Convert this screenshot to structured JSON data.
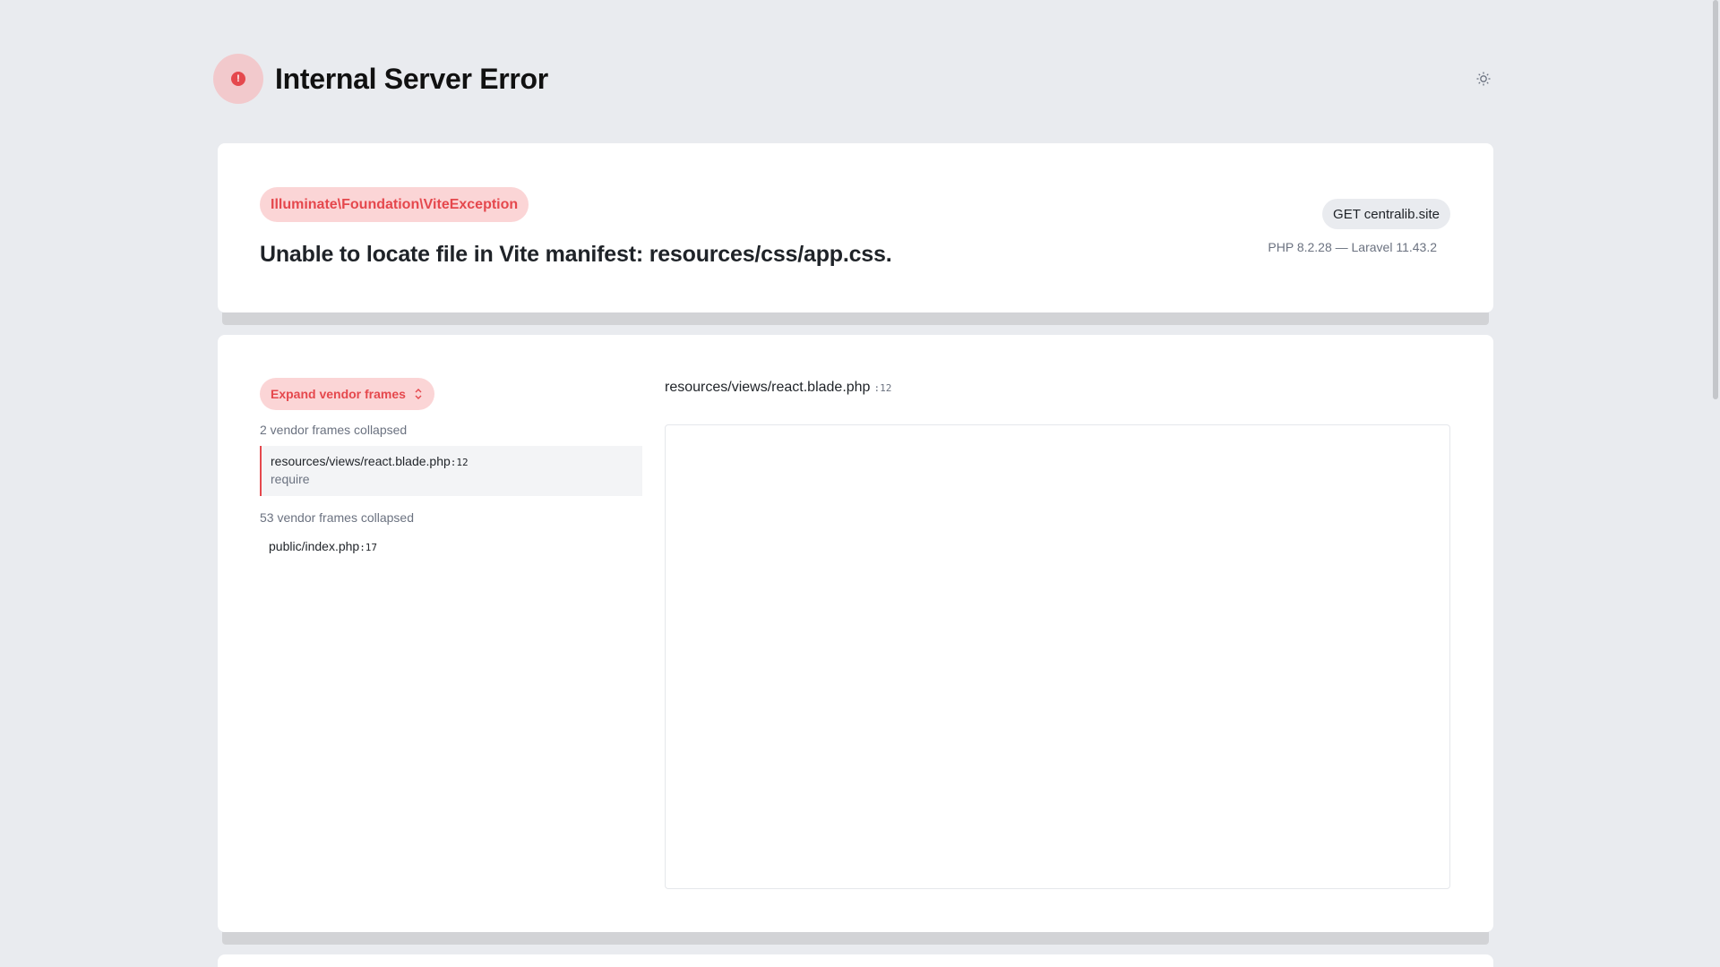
{
  "header": {
    "title": "Internal Server Error",
    "icon": "alert-circle-icon",
    "theme_icon": "sun-icon"
  },
  "exception": {
    "class": "Illuminate\\Foundation\\ViteException",
    "message": "Unable to locate file in Vite manifest: resources/css/app.css.",
    "request": "GET centralib.site",
    "versions": "PHP 8.2.28 — Laravel 11.43.2"
  },
  "trace": {
    "expand_label": "Expand vendor frames",
    "collapsed_1": "2 vendor frames collapsed",
    "frames": [
      {
        "path": "resources/views/react.blade.php",
        "line": ":12",
        "fn": "require"
      },
      {
        "path": "public/index.php",
        "line": ":17"
      }
    ],
    "collapsed_2": "53 vendor frames collapsed"
  },
  "code": {
    "file": "resources/views/react.blade.php",
    "line": ":12"
  },
  "colors": {
    "accent": "#e5484d",
    "accent_bg": "#fbd5d6",
    "page_bg": "#e9ebef"
  }
}
